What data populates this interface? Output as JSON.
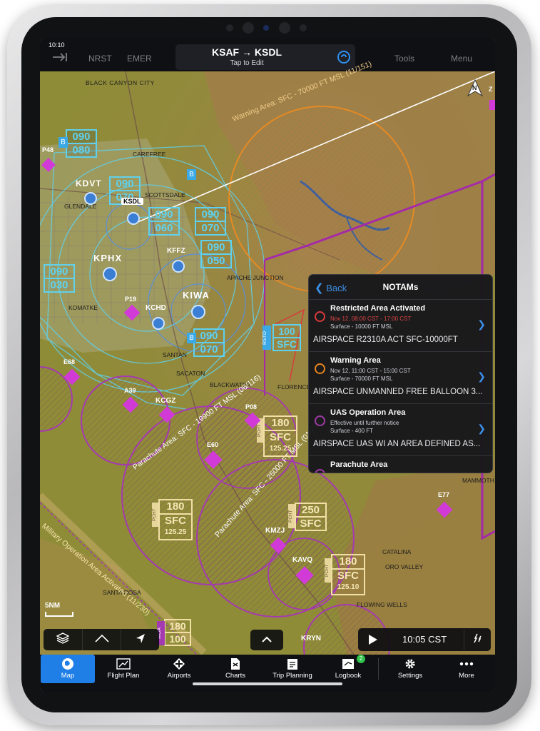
{
  "status": {
    "time": "10:10"
  },
  "topbar": {
    "nrst_label": "NRST",
    "emer_label": "EMER",
    "route_title": "KSAF → KSDL",
    "route_sub": "Tap to Edit",
    "tools_label": "Tools",
    "menu_label": "Menu",
    "direct_icon": "direct-to-icon",
    "connext_icon": "connext-icon"
  },
  "map": {
    "places": [
      "BLACK CANYON CITY",
      "CAREFREE",
      "SCOTTSDALE",
      "GLENDALE",
      "APACHE JUNCTION",
      "KOMATKE",
      "SANTAN",
      "SACATON",
      "BLACKWATER",
      "FLORENCE",
      "CATALINA",
      "ORO VALLEY",
      "SANTA ROSA",
      "FLOWING WELLS",
      "MAMMOTH"
    ],
    "airports": [
      "KDVT",
      "KSDL",
      "KPHX",
      "KFFZ",
      "KIWA",
      "P19",
      "KCHD",
      "P48",
      "E68",
      "A39",
      "KCGZ",
      "P08",
      "E60",
      "KMZJ",
      "KAVQ",
      "E77",
      "KRYN",
      "Z"
    ],
    "airspace_labels": [
      "Warning Area: SFC - 70000 FT MSL (11/151)",
      "Parachute Area: SFC - 19900 FT MSL (06/116)",
      "Parachute Area: SFC - 25000 FT MSL (01/239)",
      "Military Operation Area Activated (11/230)"
    ],
    "altitude_boxes": [
      {
        "top": "090",
        "bottom": "080"
      },
      {
        "top": "090",
        "bottom": "070"
      },
      {
        "top": "090",
        "bottom": "060"
      },
      {
        "top": "090",
        "bottom": "070"
      },
      {
        "top": "090",
        "bottom": "050"
      },
      {
        "top": "090",
        "bottom": "030"
      },
      {
        "top": "090",
        "bottom": "070"
      },
      {
        "top": "100",
        "bottom": "SFC"
      },
      {
        "top": "180",
        "bottom": "SFC",
        "extra": "125.25"
      },
      {
        "top": "180",
        "bottom": "SFC",
        "extra": "125.25"
      },
      {
        "top": "250",
        "bottom": "SFC"
      },
      {
        "top": "180",
        "bottom": "SFC",
        "extra": "125.10"
      },
      {
        "top": "180",
        "bottom": "100"
      }
    ],
    "side_tags": [
      "RSTD",
      "PCHT",
      "PCHT",
      "PCHT",
      "PCHT",
      "MOA"
    ],
    "class_b_tag": "B",
    "north_label": "N",
    "scale_label": "5NM"
  },
  "notams": {
    "back_label": "Back",
    "title": "NOTAMs",
    "items": [
      {
        "title": "Restricted Area Activated",
        "line1": "Nov 12, 08:00 CST - 17:00 CST",
        "line2": "Surface - 10000 FT MSL",
        "text": "AIRSPACE R2310A ACT SFC-10000FT",
        "color": "#d83a3a",
        "line1_color": "#e04545"
      },
      {
        "title": "Warning Area",
        "line1": "Nov 12, 11:00 CST - 15:00 CST",
        "line2": "Surface - 70000 FT MSL",
        "text": "AIRSPACE UNMANNED FREE BALLOON 3...",
        "color": "#e8841e",
        "line1_color": "#cfd2d8"
      },
      {
        "title": "UAS Operation Area",
        "line1": "Effective until further notice",
        "line2": "Surface - 400 FT",
        "text": "AIRSPACE UAS WI AN AREA DEFINED AS...",
        "color": "#a03aa5",
        "line1_color": "#cfd2d8"
      },
      {
        "title": "Parachute Area",
        "color": "#a03aa5"
      }
    ]
  },
  "controls": {
    "layers_icon": "layers-icon",
    "route_icon": "route-icon",
    "track_icon": "track-up-icon",
    "expand_icon": "chevron-up-icon",
    "play_icon": "play-icon",
    "time_label": "10:05 CST",
    "weather_icon": "lightning-icon"
  },
  "bottom_nav": [
    {
      "label": "Map",
      "icon": "globe-icon",
      "active": true
    },
    {
      "label": "Flight Plan",
      "icon": "flight-plan-icon"
    },
    {
      "label": "Airports",
      "icon": "airports-icon"
    },
    {
      "label": "Charts",
      "icon": "charts-icon"
    },
    {
      "label": "Trip Planning",
      "icon": "trip-planning-icon"
    },
    {
      "label": "Logbook",
      "icon": "logbook-icon",
      "badge": "2"
    },
    {
      "label": "Settings",
      "icon": "gear-icon"
    },
    {
      "label": "More",
      "icon": "more-icon"
    }
  ],
  "colors": {
    "accent": "#1f7fe6",
    "airspace_magenta": "#a43ab0",
    "class_b_cyan": "#5fd1ee",
    "warning_orange": "#e58a24",
    "terrain": "#8b8a35"
  }
}
